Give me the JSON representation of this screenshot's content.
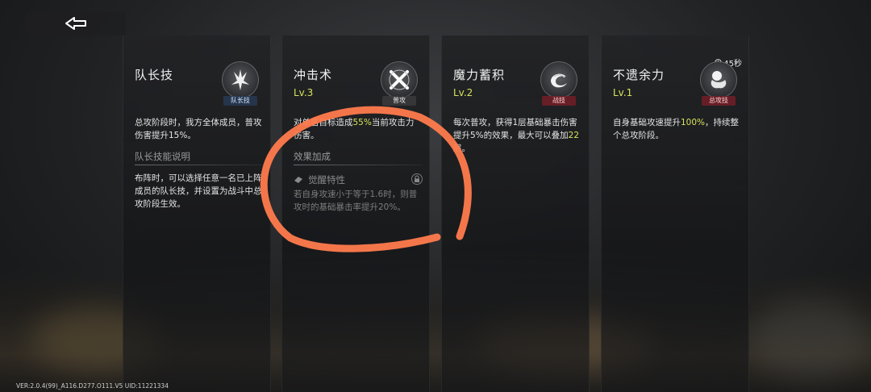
{
  "header": {
    "back_icon": "back-arrow-icon"
  },
  "cards": [
    {
      "title": "队长技",
      "level": "",
      "icon": "leader-skill-icon",
      "tag": "队长技",
      "description": "总攻阶段时，我方全体成员，普攻伤害提升15%。",
      "section_title": "队长技能说明",
      "section_text": "布阵时，可以选择任意一名已上阵成员的队长技，并设置为战斗中总攻阶段生效。"
    },
    {
      "title": "冲击术",
      "level": "Lv.3",
      "icon": "strike-skill-icon",
      "tag": "普攻",
      "description_pre": "对",
      "description_obscured": "单",
      "description_mid": "名目标造成",
      "description_hl": "55%",
      "description_post": "当前攻击力伤害。",
      "section_title": "效果加成",
      "locked_title": "觉醒特性",
      "locked_text": "若自身攻速小于等于1.6时，则普攻时的基础暴击率提升20%。"
    },
    {
      "title": "魔力蓄积",
      "level": "Lv.2",
      "icon": "mana-charge-icon",
      "tag": "战技",
      "description_pre": "每次普攻，获得1层基础暴击伤害提升5%的效果，最大可以叠加",
      "description_hl": "22",
      "description_post": "层。"
    },
    {
      "title": "不遗余力",
      "level": "Lv.1",
      "icon": "all-out-skill-icon",
      "tag": "总攻技",
      "timer": "45秒",
      "description_pre": "自身基础攻速提升",
      "description_hl": "100%",
      "description_post": "，持续整个总攻阶段。"
    }
  ],
  "footer": {
    "version": "VER:2.0.4(99)_A116.D277.O111.V5   UID:11221334"
  },
  "colors": {
    "highlight": "#d7e35a",
    "annotation": "#ff7b4d"
  }
}
